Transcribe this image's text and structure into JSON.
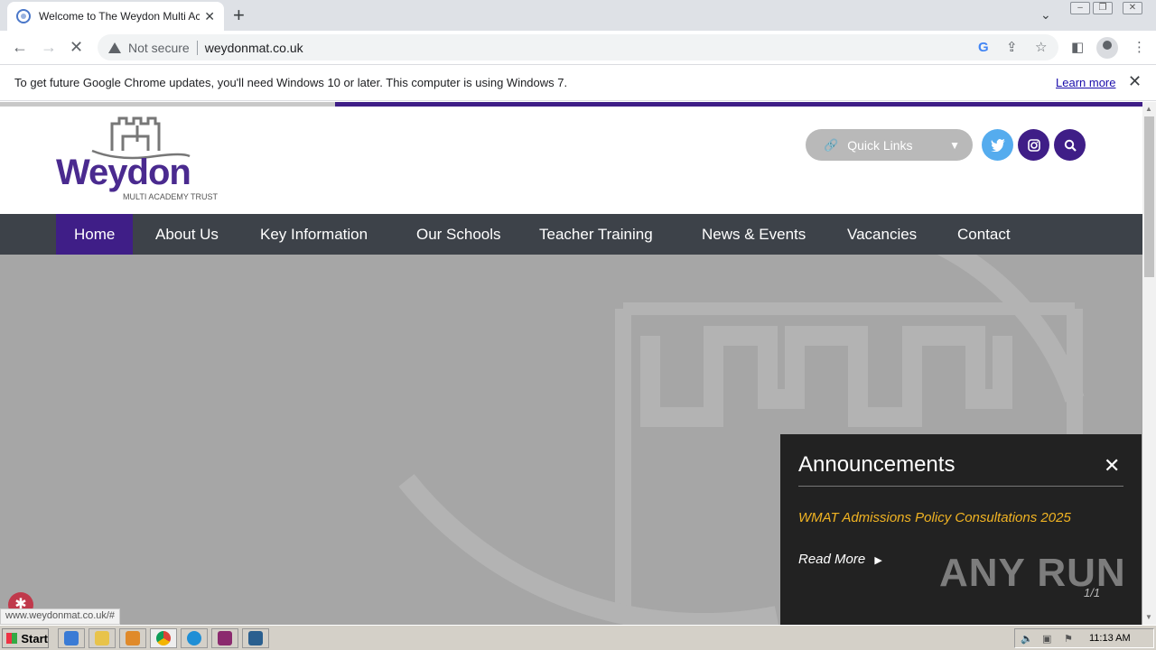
{
  "browser": {
    "tab_title": "Welcome to The Weydon Multi Academy Trust",
    "new_tab": "+",
    "security_label": "Not secure",
    "url": "weydonmat.co.uk"
  },
  "infobar": {
    "message": "To get future Google Chrome updates, you'll need Windows 10 or later. This computer is using Windows 7.",
    "learn_more": "Learn more"
  },
  "site": {
    "logo_word": "Weydon",
    "logo_sub": "MULTI ACADEMY TRUST",
    "quick_links": "Quick Links",
    "nav": [
      {
        "label": "Home"
      },
      {
        "label": "About Us"
      },
      {
        "label": "Key Information"
      },
      {
        "label": "Our Schools"
      },
      {
        "label": "Teacher Training"
      },
      {
        "label": "News & Events"
      },
      {
        "label": "Vacancies"
      },
      {
        "label": "Contact"
      }
    ],
    "colors": {
      "brand": "#3f1e87",
      "nav_bg": "#3d4249",
      "twitter": "#55acee",
      "accent": "#f0b323"
    }
  },
  "announcements": {
    "title": "Announcements",
    "item": "WMAT Admissions Policy Consultations 2025",
    "read_more": "Read More",
    "counter": "1/1"
  },
  "status_url": "www.weydonmat.co.uk/#",
  "watermark": "ANY RUN",
  "taskbar": {
    "start": "Start",
    "clock": "11:13 AM"
  }
}
